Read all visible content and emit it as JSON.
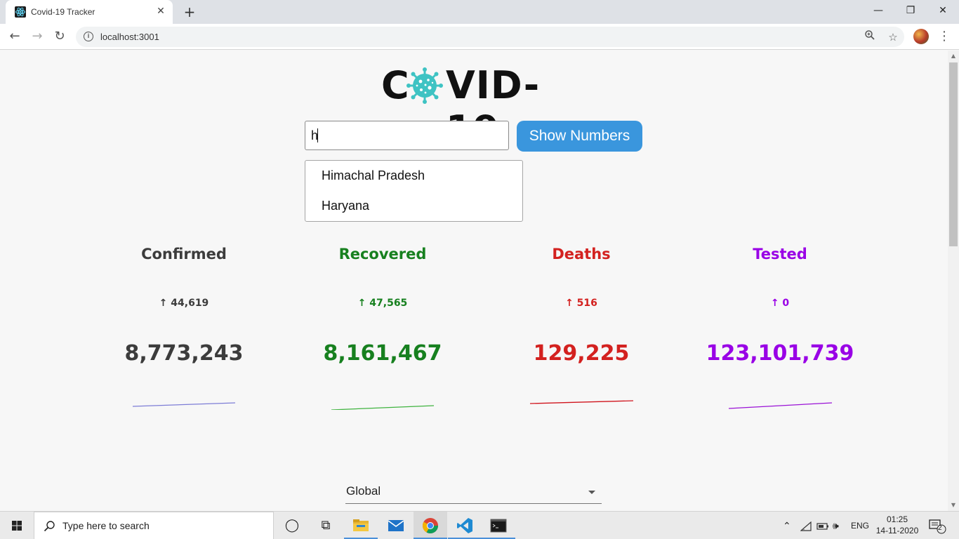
{
  "browser": {
    "tab_title": "Covid-19 Tracker",
    "tab_close": "✕",
    "new_tab": "+",
    "url": "localhost:3001",
    "window": {
      "minimize": "—",
      "restore": "❐",
      "close": "✕"
    }
  },
  "page": {
    "logo_text_left": "C",
    "logo_text_right": "VID-19",
    "search": {
      "value": "h"
    },
    "show_button": "Show Numbers",
    "suggestions": [
      "Himachal Pradesh",
      "Haryana"
    ],
    "stats": [
      {
        "title": "Confirmed",
        "delta": "↑ 44,619",
        "total": "8,773,243",
        "color": "#3c3c3c",
        "line_color": "#7d7dd6"
      },
      {
        "title": "Recovered",
        "delta": "↑ 47,565",
        "total": "8,161,467",
        "color": "#17801f",
        "line_color": "#3fb33f"
      },
      {
        "title": "Deaths",
        "delta": "↑ 516",
        "total": "129,225",
        "color": "#d3211f",
        "line_color": "#d0141c"
      },
      {
        "title": "Tested",
        "delta": "↑ 0",
        "total": "123,101,739",
        "color": "#9900e6",
        "line_color": "#9a12d6"
      }
    ],
    "region_select": {
      "value": "Global"
    }
  },
  "taskbar": {
    "search_placeholder": "Type here to search",
    "language": "ENG",
    "time": "01:25",
    "date": "14-11-2020",
    "notification_count": "2"
  }
}
